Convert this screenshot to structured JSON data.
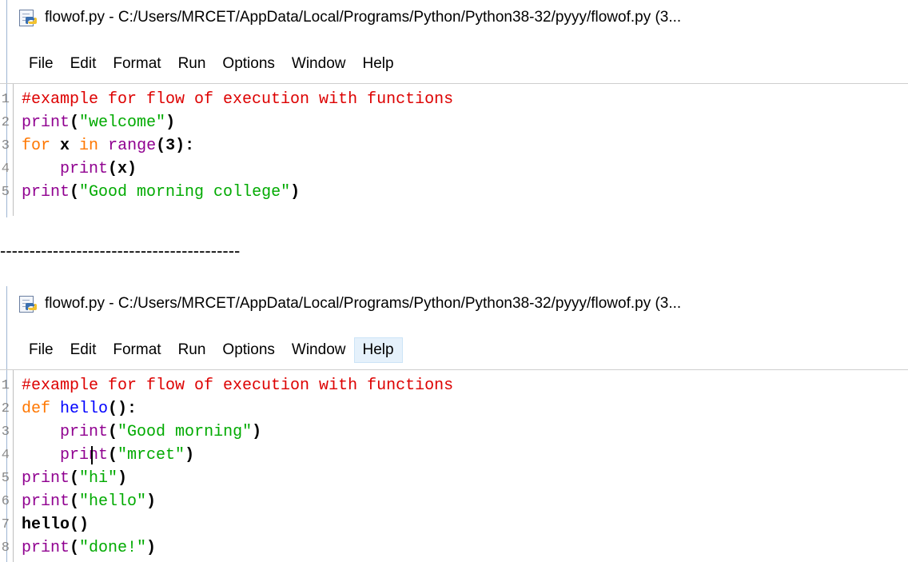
{
  "windows": [
    {
      "title": "flowof.py - C:/Users/MRCET/AppData/Local/Programs/Python/Python38-32/pyyy/flowof.py (3...",
      "menu": [
        "File",
        "Edit",
        "Format",
        "Run",
        "Options",
        "Window",
        "Help"
      ],
      "lines": [
        {
          "num": "1",
          "tokens": [
            {
              "t": "#example for flow of execution with functions",
              "c": "comment"
            }
          ]
        },
        {
          "num": "2",
          "tokens": [
            {
              "t": "print",
              "c": "builtin"
            },
            {
              "t": "(",
              "c": "plain"
            },
            {
              "t": "\"welcome\"",
              "c": "str"
            },
            {
              "t": ")",
              "c": "plain"
            }
          ]
        },
        {
          "num": "3",
          "tokens": [
            {
              "t": "for",
              "c": "kw"
            },
            {
              "t": " x ",
              "c": "plain"
            },
            {
              "t": "in",
              "c": "kw"
            },
            {
              "t": " ",
              "c": "plain"
            },
            {
              "t": "range",
              "c": "builtin"
            },
            {
              "t": "(3):",
              "c": "plain"
            }
          ]
        },
        {
          "num": "4",
          "tokens": [
            {
              "t": "    ",
              "c": "plain"
            },
            {
              "t": "print",
              "c": "builtin"
            },
            {
              "t": "(x)",
              "c": "plain"
            }
          ]
        },
        {
          "num": "5",
          "tokens": [
            {
              "t": "print",
              "c": "builtin"
            },
            {
              "t": "(",
              "c": "plain"
            },
            {
              "t": "\"Good morning college\"",
              "c": "str"
            },
            {
              "t": ")",
              "c": "plain"
            }
          ]
        }
      ]
    },
    {
      "title": "flowof.py - C:/Users/MRCET/AppData/Local/Programs/Python/Python38-32/pyyy/flowof.py (3...",
      "menu": [
        "File",
        "Edit",
        "Format",
        "Run",
        "Options",
        "Window",
        "Help"
      ],
      "hovered_menu": "Help",
      "lines": [
        {
          "num": "1",
          "tokens": [
            {
              "t": "#example for flow of execution with functions",
              "c": "comment"
            }
          ]
        },
        {
          "num": "2",
          "tokens": [
            {
              "t": "def",
              "c": "kw"
            },
            {
              "t": " ",
              "c": "plain"
            },
            {
              "t": "hello",
              "c": "def"
            },
            {
              "t": "():",
              "c": "plain"
            }
          ]
        },
        {
          "num": "3",
          "tokens": [
            {
              "t": "    ",
              "c": "plain"
            },
            {
              "t": "print",
              "c": "builtin"
            },
            {
              "t": "(",
              "c": "plain"
            },
            {
              "t": "\"Good morning\"",
              "c": "str"
            },
            {
              "t": ")",
              "c": "plain"
            }
          ]
        },
        {
          "num": "4",
          "tokens": [
            {
              "t": "    ",
              "c": "plain"
            },
            {
              "t": "print",
              "c": "builtin"
            },
            {
              "t": "(",
              "c": "plain"
            },
            {
              "t": "\"mrcet\"",
              "c": "str"
            },
            {
              "t": ")",
              "c": "plain"
            }
          ]
        },
        {
          "num": "5",
          "tokens": [
            {
              "t": "print",
              "c": "builtin"
            },
            {
              "t": "(",
              "c": "plain"
            },
            {
              "t": "\"hi\"",
              "c": "str"
            },
            {
              "t": ")",
              "c": "plain"
            }
          ]
        },
        {
          "num": "6",
          "tokens": [
            {
              "t": "print",
              "c": "builtin"
            },
            {
              "t": "(",
              "c": "plain"
            },
            {
              "t": "\"hello\"",
              "c": "str"
            },
            {
              "t": ")",
              "c": "plain"
            }
          ]
        },
        {
          "num": "7",
          "tokens": [
            {
              "t": "hello()",
              "c": "plain"
            }
          ]
        },
        {
          "num": "8",
          "tokens": [
            {
              "t": "print",
              "c": "builtin"
            },
            {
              "t": "(",
              "c": "plain"
            },
            {
              "t": "\"done!\"",
              "c": "str"
            },
            {
              "t": ")",
              "c": "plain"
            }
          ]
        }
      ]
    }
  ],
  "separator": "-----------------------------------------",
  "icons": {
    "title_icon": "python-file-icon"
  }
}
